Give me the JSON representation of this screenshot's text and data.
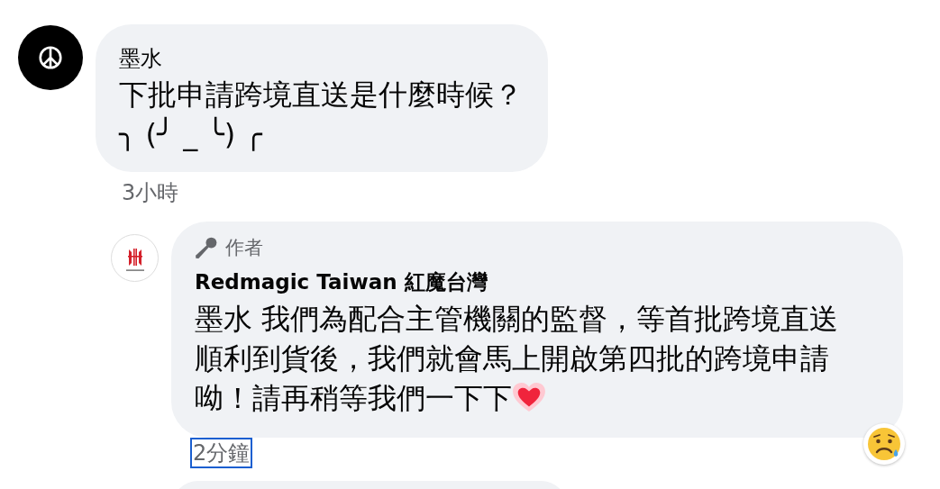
{
  "comments": [
    {
      "author": "墨水",
      "text": "下批申請跨境直送是什麼時候？\n╮ (╯ _ ╰) ╭",
      "time": "3小時",
      "time_focused": false,
      "replies": [
        {
          "badge": "作者",
          "author": "Redmagic Taiwan 紅魔台灣",
          "text": "墨水 我們為配合主管機關的監督，等首批跨境直送順利到貨後，我們就會馬上開啟第四批的跨境申請呦！請再稍等我們一下下",
          "ends_with_heart": true,
          "reacted": true,
          "time": "2分鐘",
          "time_focused": true
        }
      ]
    }
  ]
}
